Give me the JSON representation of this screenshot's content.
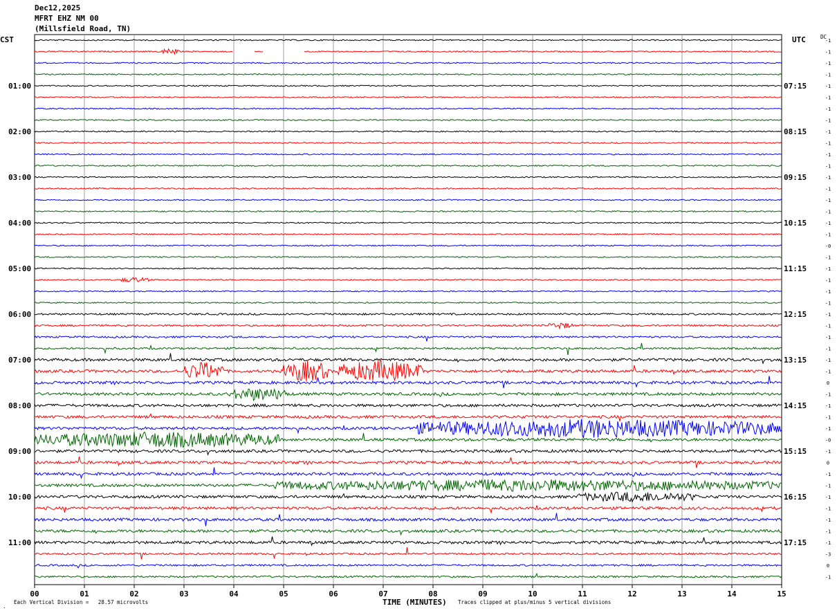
{
  "header": {
    "date": "Dec12,2025",
    "station": "MFRT EHZ NM 00",
    "location": "(Millsfield Road, TN)"
  },
  "chart_data": {
    "type": "line",
    "left_timezone": "CST",
    "right_timezone": "UTC",
    "dc_label": "DC",
    "xlabel": "TIME (MINUTES)",
    "x_ticks": [
      "00",
      "01",
      "02",
      "03",
      "04",
      "05",
      "06",
      "07",
      "08",
      "09",
      "10",
      "11",
      "12",
      "13",
      "14",
      "15"
    ],
    "xlim": [
      0,
      15
    ],
    "left_hour_labels": [
      "01:00",
      "02:00",
      "03:00",
      "04:00",
      "05:00",
      "06:00",
      "07:00",
      "08:00",
      "09:00",
      "10:00",
      "11:00"
    ],
    "right_hour_labels": [
      "07:15",
      "08:15",
      "09:15",
      "10:15",
      "11:15",
      "12:15",
      "13:15",
      "14:15",
      "15:15",
      "16:15",
      "17:15"
    ],
    "trace_colors": [
      "#000000",
      "#ff0000",
      "#0000ff",
      "#006400"
    ],
    "trace_count": 48,
    "dc_offsets": [
      "-1",
      "-1",
      "-1",
      "-1",
      "-1",
      "-1",
      "-1",
      "-1",
      "-1",
      "-1",
      "-1",
      "-1",
      "-1",
      "-1",
      "-1",
      "-1",
      "-1",
      "-1",
      "-0",
      "-1",
      "-1",
      "-1",
      "-1",
      "-1",
      "-1",
      "-1",
      "-1",
      "-1",
      "-1",
      "-1",
      "0",
      "-1",
      "-1",
      "-1",
      "-1",
      "-0",
      "-1",
      "0",
      "-1",
      "-1",
      "-1",
      "-1",
      "-1",
      "-1",
      "-1",
      "-3",
      "0",
      "-1"
    ],
    "events": [
      {
        "trace": 1,
        "start": 2.5,
        "end": 2.9,
        "amp": 5,
        "comment": "small event"
      },
      {
        "trace": 21,
        "start": 1.7,
        "end": 2.3,
        "amp": 4
      },
      {
        "trace": 25,
        "start": 10.3,
        "end": 10.8,
        "amp": 5
      },
      {
        "trace": 29,
        "start": 3.0,
        "end": 3.8,
        "amp": 14
      },
      {
        "trace": 29,
        "start": 5.0,
        "end": 5.9,
        "amp": 16
      },
      {
        "trace": 29,
        "start": 6.1,
        "end": 7.8,
        "amp": 16
      },
      {
        "trace": 31,
        "start": 3.9,
        "end": 5.1,
        "amp": 10
      },
      {
        "trace": 34,
        "start": 7.6,
        "end": 15.0,
        "amp": 14
      },
      {
        "trace": 35,
        "start": 0.0,
        "end": 4.9,
        "amp": 12
      },
      {
        "trace": 39,
        "start": 4.8,
        "end": 15.0,
        "amp": 9
      },
      {
        "trace": 40,
        "start": 10.9,
        "end": 13.3,
        "amp": 8
      }
    ],
    "gaps": [
      {
        "trace": 1,
        "start": 4.0,
        "end": 4.4
      },
      {
        "trace": 1,
        "start": 4.6,
        "end": 5.4
      }
    ],
    "footer_left": "Each Vertical Division =   28.57 microvolts",
    "footer_right": "Traces clipped at plus/minus 5 vertical divisions"
  }
}
